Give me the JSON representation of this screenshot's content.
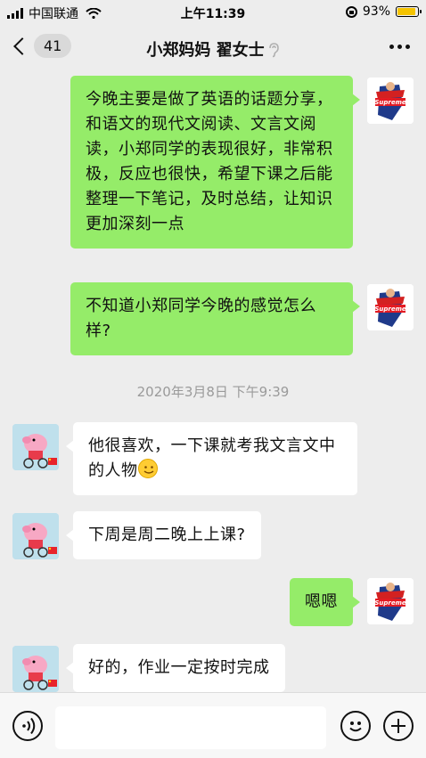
{
  "status_bar": {
    "carrier": "中国联通",
    "time": "上午11:39",
    "battery": "93%",
    "battery_level": 0.93
  },
  "nav": {
    "unread_count": "41",
    "title": "小郑妈妈 翟女士"
  },
  "messages": [
    {
      "sender": "me",
      "text": "今晚主要是做了英语的话题分享，和语文的现代文阅读、文言文阅读，小郑同学的表现很好，非常积极，反应也很快，希望下课之后能整理一下笔记，及时总结，让知识更加深刻一点"
    },
    {
      "sender": "me",
      "text": "不知道小郑同学今晚的感觉怎么样?"
    },
    {
      "timestamp": "2020年3月8日 下午9:39"
    },
    {
      "sender": "other",
      "text": "他很喜欢，一下课就考我文言文中的人物"
    },
    {
      "sender": "other",
      "text": "下周是周二晚上上课?"
    },
    {
      "sender": "me",
      "text": "嗯嗯"
    },
    {
      "sender": "other",
      "text": "好的，作业一定按时完成"
    }
  ],
  "avatars": {
    "me_brand": "Supreme"
  },
  "colors": {
    "my_bubble": "#95ec69",
    "their_bubble": "#ffffff",
    "background": "#ededed"
  }
}
